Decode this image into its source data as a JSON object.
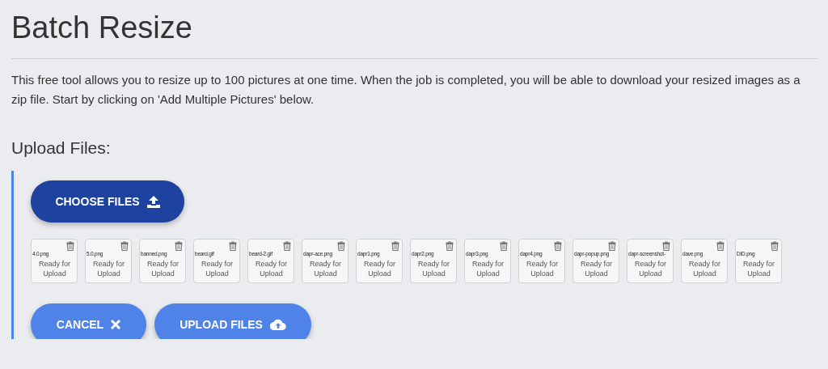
{
  "title": "Batch Resize",
  "description": "This free tool allows you to resize up to 100 pictures at one time. When the job is completed, you will be able to download your resized images as a zip file. Start by clicking on 'Add Multiple Pictures' below.",
  "upload": {
    "heading": "Upload Files:",
    "choose_button": {
      "label": "CHOOSE FILES"
    },
    "files": [
      {
        "name": "4.0.png",
        "status": "Ready for Upload"
      },
      {
        "name": "5.0.png",
        "status": "Ready for Upload"
      },
      {
        "name": "banned.png",
        "status": "Ready for Upload"
      },
      {
        "name": "beard.gif",
        "status": "Ready for Upload"
      },
      {
        "name": "beard-2.gif",
        "status": "Ready for Upload"
      },
      {
        "name": "dapr-ace.png",
        "status": "Ready for Upload"
      },
      {
        "name": "dapr1.png",
        "status": "Ready for Upload"
      },
      {
        "name": "dapr2.png",
        "status": "Ready for Upload"
      },
      {
        "name": "dapr3.png",
        "status": "Ready for Upload"
      },
      {
        "name": "dapr4.png",
        "status": "Ready for Upload"
      },
      {
        "name": "dapr-popup.png",
        "status": "Ready for Upload"
      },
      {
        "name": "dapr-screenshot-",
        "status": "Ready for Upload"
      },
      {
        "name": "dave.png",
        "status": "Ready for Upload"
      },
      {
        "name": "DID.png",
        "status": "Ready for Upload"
      }
    ],
    "actions": [
      {
        "kind": "cancel",
        "label": "CANCEL"
      },
      {
        "kind": "upload",
        "label": "UPLOAD FILES"
      }
    ]
  }
}
